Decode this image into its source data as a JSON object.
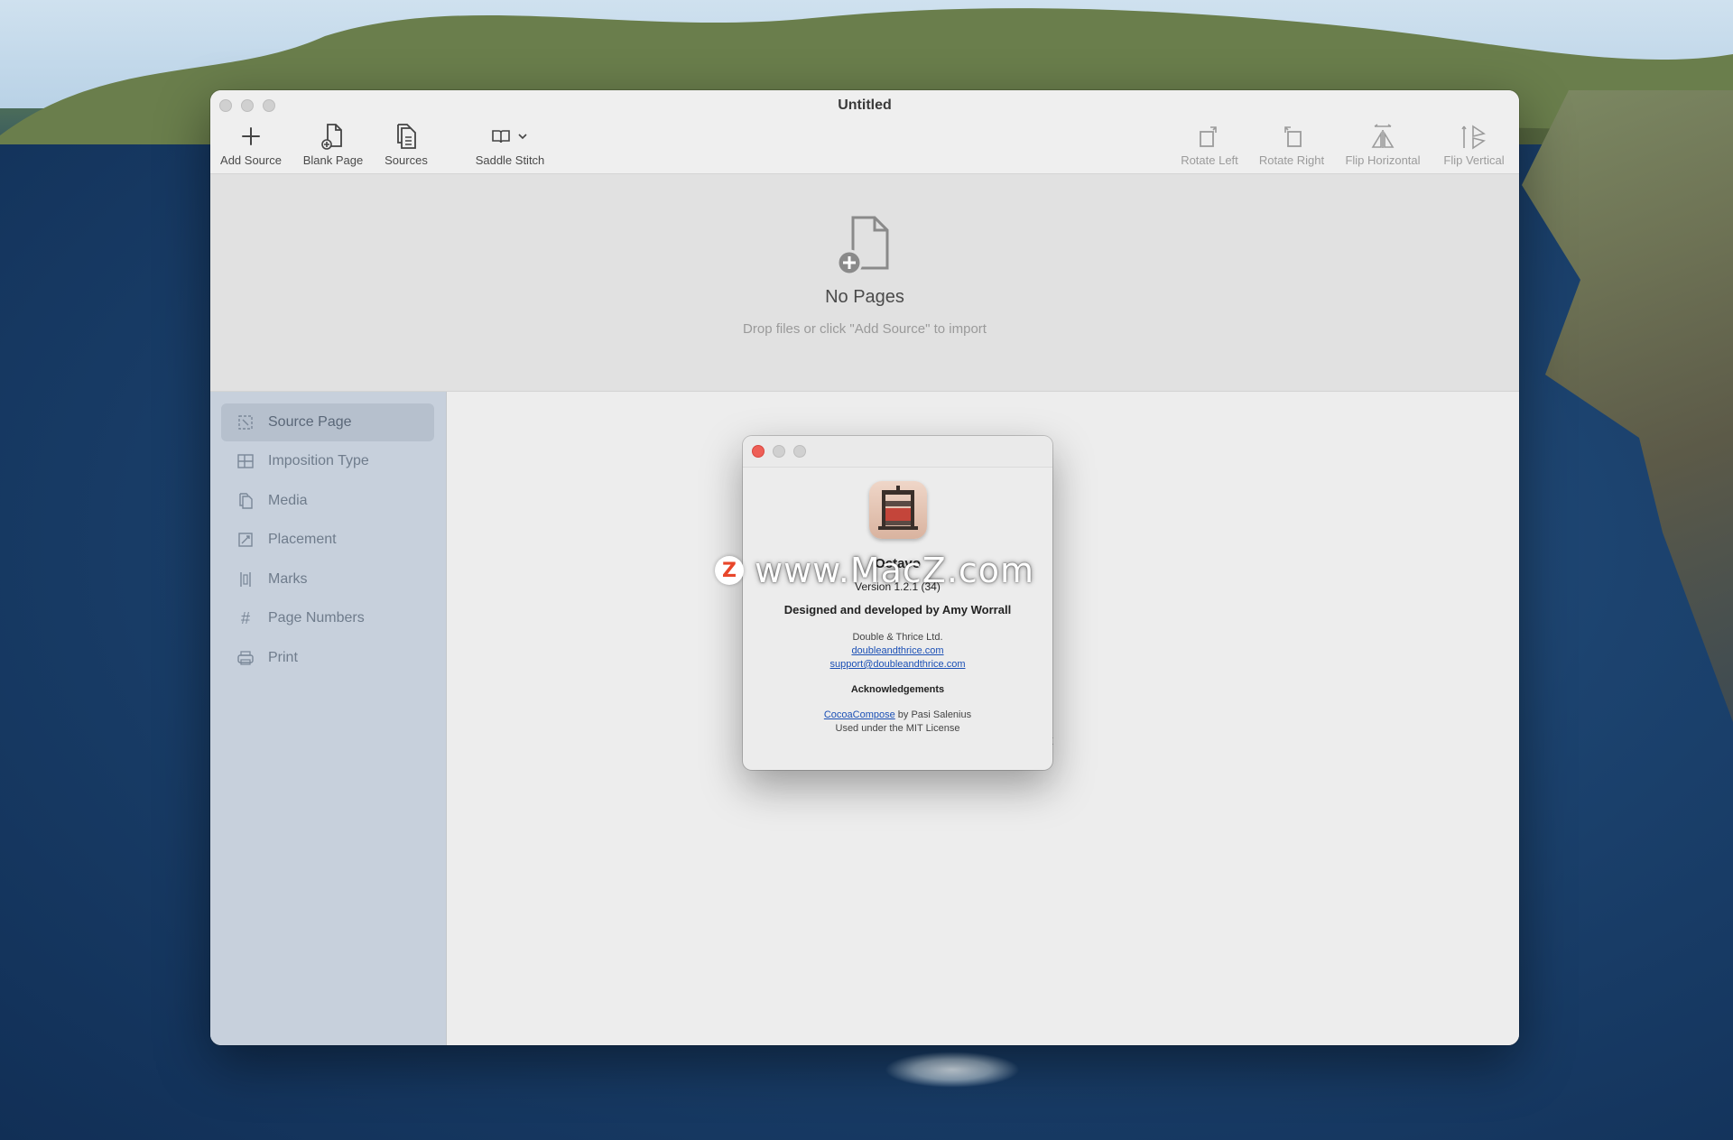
{
  "window": {
    "title": "Untitled"
  },
  "toolbar": {
    "left": [
      {
        "label": "Add Source",
        "icon": "plus-icon"
      },
      {
        "label": "Blank Page",
        "icon": "blank-page-icon"
      },
      {
        "label": "Sources",
        "icon": "sources-icon"
      },
      {
        "label": "Saddle Stitch",
        "icon": "book-icon"
      }
    ],
    "right": [
      {
        "label": "Rotate Left",
        "icon": "rotate-left-icon"
      },
      {
        "label": "Rotate Right",
        "icon": "rotate-right-icon"
      },
      {
        "label": "Flip Horizontal",
        "icon": "flip-horizontal-icon"
      },
      {
        "label": "Flip Vertical",
        "icon": "flip-vertical-icon"
      }
    ]
  },
  "empty_state": {
    "title": "No Pages",
    "subtitle": "Drop files or click \"Add Source\" to import"
  },
  "sidebar": {
    "items": [
      {
        "label": "Source Page",
        "icon": "source-page-icon",
        "selected": true
      },
      {
        "label": "Imposition Type",
        "icon": "grid-icon",
        "selected": false
      },
      {
        "label": "Media",
        "icon": "media-icon",
        "selected": false
      },
      {
        "label": "Placement",
        "icon": "placement-icon",
        "selected": false
      },
      {
        "label": "Marks",
        "icon": "marks-icon",
        "selected": false
      },
      {
        "label": "Page Numbers",
        "icon": "hash-icon",
        "selected": false
      },
      {
        "label": "Print",
        "icon": "print-icon",
        "selected": false
      }
    ]
  },
  "content": {
    "partial_text": "ct"
  },
  "about": {
    "app_name": "Octavo",
    "version": "Version 1.2.1 (34)",
    "credit": "Designed and developed by Amy Worrall",
    "company": "Double & Thrice Ltd.",
    "website": "doubleandthrice.com",
    "email": "support@doubleandthrice.com",
    "ack_heading": "Acknowledgements",
    "ack_link": "CocoaCompose",
    "ack_by": " by Pasi Salenius",
    "ack_license": "Used under the MIT License"
  },
  "watermark": {
    "badge": "Z",
    "text": "www.MacZ.com"
  },
  "colors": {
    "sidebar_bg": "#c7d0dc",
    "close_red": "#ee5f57",
    "link": "#1a4fb5"
  }
}
